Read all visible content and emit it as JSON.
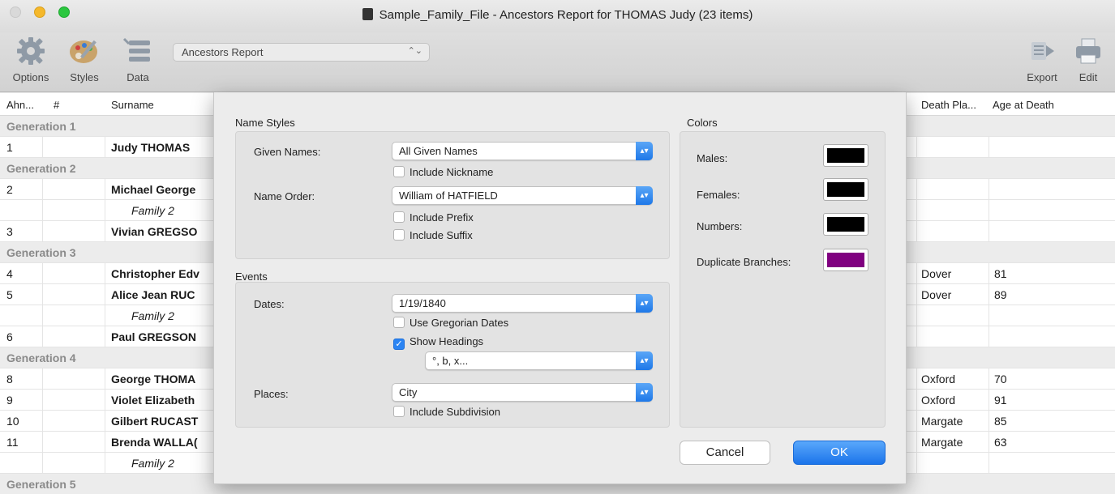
{
  "window": {
    "title": "Sample_Family_File - Ancestors Report for THOMAS Judy (23 items)"
  },
  "toolbar": {
    "options_label": "Options",
    "styles_label": "Styles",
    "data_label": "Data",
    "report_select": "Ancestors Report",
    "export_label": "Export",
    "edit_label": "Edit"
  },
  "table": {
    "headers": {
      "ahn": "Ahn...",
      "num": "#",
      "surname": "Surname",
      "death_place": "Death Pla...",
      "age_at_death": "Age at Death"
    },
    "rows": [
      {
        "type": "gen",
        "label": "Generation 1"
      },
      {
        "type": "person",
        "ahn": "1",
        "name": "Judy THOMAS",
        "death_place": "",
        "age": ""
      },
      {
        "type": "gen",
        "label": "Generation 2"
      },
      {
        "type": "person",
        "ahn": "2",
        "name": "Michael George",
        "death_place": "",
        "age": ""
      },
      {
        "type": "family",
        "ahn": "",
        "name": "Family 2",
        "death_place": "",
        "age": ""
      },
      {
        "type": "person",
        "ahn": "3",
        "name": "Vivian GREGSO",
        "death_place": "",
        "age": ""
      },
      {
        "type": "gen",
        "label": "Generation 3"
      },
      {
        "type": "person",
        "ahn": "4",
        "name": "Christopher Edv",
        "death_place": "Dover",
        "age": "81"
      },
      {
        "type": "person",
        "ahn": "5",
        "name": "Alice Jean RUC",
        "death_place": "Dover",
        "age": "89"
      },
      {
        "type": "family",
        "ahn": "",
        "name": "Family 2",
        "death_place": "",
        "age": ""
      },
      {
        "type": "person",
        "ahn": "6",
        "name": "Paul GREGSON",
        "death_place": "",
        "age": ""
      },
      {
        "type": "gen",
        "label": "Generation 4"
      },
      {
        "type": "person",
        "ahn": "8",
        "name": "George THOMA",
        "death_place": "Oxford",
        "age": "70"
      },
      {
        "type": "person",
        "ahn": "9",
        "name": "Violet Elizabeth",
        "death_place": "Oxford",
        "age": "91"
      },
      {
        "type": "person",
        "ahn": "10",
        "name": "Gilbert RUCAST",
        "death_place": "Margate",
        "age": "85"
      },
      {
        "type": "person",
        "ahn": "11",
        "name": "Brenda WALLA(",
        "death_place": "Margate",
        "age": "63"
      },
      {
        "type": "family",
        "ahn": "",
        "name": "Family 2",
        "death_place": "",
        "age": ""
      },
      {
        "type": "gen",
        "label": "Generation 5"
      }
    ]
  },
  "dialog": {
    "name_styles": {
      "title": "Name Styles",
      "given_names_label": "Given Names:",
      "given_names_value": "All Given Names",
      "include_nickname": "Include Nickname",
      "name_order_label": "Name Order:",
      "name_order_value": "William of HATFIELD",
      "include_prefix": "Include Prefix",
      "include_suffix": "Include Suffix"
    },
    "events": {
      "title": "Events",
      "dates_label": "Dates:",
      "dates_value": "1/19/1840",
      "use_gregorian": "Use Gregorian Dates",
      "show_headings": "Show Headings",
      "headings_value": "°, b, x...",
      "places_label": "Places:",
      "places_value": "City",
      "include_subdivision": "Include Subdivision"
    },
    "colors": {
      "title": "Colors",
      "males_label": "Males:",
      "males_color": "#000000",
      "females_label": "Females:",
      "females_color": "#000000",
      "numbers_label": "Numbers:",
      "numbers_color": "#000000",
      "duplicate_label": "Duplicate Branches:",
      "duplicate_color": "#800080"
    },
    "cancel_label": "Cancel",
    "ok_label": "OK"
  }
}
